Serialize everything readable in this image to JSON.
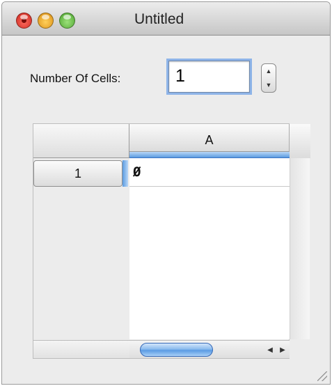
{
  "window": {
    "title": "Untitled"
  },
  "form": {
    "cell_count_label": "Number Of Cells:",
    "cell_count_value": "1"
  },
  "table": {
    "columns": [
      "A"
    ],
    "rows": [
      {
        "header": "1",
        "cells": [
          "Ø"
        ]
      }
    ]
  },
  "colors": {
    "selection": "#5b9be0",
    "focus_ring": "#8eb4e8"
  }
}
